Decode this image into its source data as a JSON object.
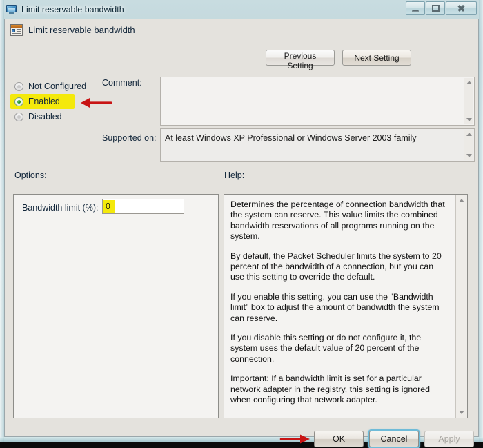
{
  "window": {
    "title": "Limit reservable bandwidth",
    "title_icon": "monitor-icon",
    "caption_buttons": {
      "minimize_label": "Minimize",
      "maximize_label": "Maximize",
      "close_label": "Close"
    }
  },
  "header": {
    "icon": "policy-setting-icon",
    "title": "Limit reservable bandwidth",
    "previous_setting_label": "Previous Setting",
    "next_setting_label": "Next Setting"
  },
  "state": {
    "options": [
      {
        "label": "Not Configured",
        "selected": false,
        "highlighted": false
      },
      {
        "label": "Enabled",
        "selected": true,
        "highlighted": true
      },
      {
        "label": "Disabled",
        "selected": false,
        "highlighted": false
      }
    ]
  },
  "comment": {
    "label": "Comment:",
    "value": "",
    "placeholder": ""
  },
  "supported": {
    "label": "Supported on:",
    "value": "At least Windows XP Professional or Windows Server 2003 family"
  },
  "sections": {
    "options_label": "Options:",
    "help_label": "Help:"
  },
  "options_panel": {
    "bandwidth_label": "Bandwidth limit (%):",
    "bandwidth_value": "0",
    "bandwidth_highlighted": true,
    "spinner_up": "increment",
    "spinner_down": "decrement"
  },
  "help_panel": {
    "paragraphs": [
      "Determines the percentage of connection bandwidth that the system can reserve. This value limits the combined bandwidth reservations of all programs running on the system.",
      "By default, the Packet Scheduler limits the system to 20 percent of the bandwidth of a connection, but you can use this setting to override the default.",
      "If you enable this setting, you can use the \"Bandwidth limit\" box to adjust the amount of bandwidth the system can reserve.",
      "If you disable this setting or do not configure it, the system uses the default value of 20 percent of the connection.",
      "Important: If a bandwidth limit is set for a particular network adapter in the registry, this setting is ignored when configuring that network adapter."
    ]
  },
  "footer": {
    "ok_label": "OK",
    "cancel_label": "Cancel",
    "apply_label": "Apply",
    "apply_disabled": true
  },
  "annotations": {
    "arrow_enabled": "red-arrow-pointing-to-enabled",
    "arrow_ok": "red-arrow-pointing-to-ok"
  },
  "colors": {
    "highlight_yellow": "#f4e90b",
    "annotation_red": "#c81414",
    "focus_blue": "#6fbbd8",
    "dialog_bg": "#e4e2dd",
    "panel_bg": "#f4f3f1"
  }
}
